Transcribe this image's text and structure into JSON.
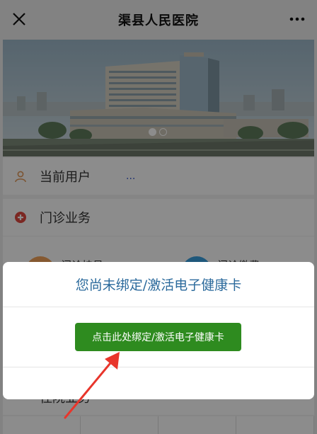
{
  "topbar": {
    "title": "渠县人民医院",
    "close_icon": "close-icon",
    "more_icon": "more-icon"
  },
  "banner": {
    "slides": 2,
    "active_slide": 1
  },
  "user": {
    "label": "当前用户",
    "value": "...",
    "icon": "user-icon"
  },
  "outpatient": {
    "label": "门诊业务",
    "icon": "plus-circle-icon"
  },
  "grid": {
    "items": [
      {
        "label": "门诊挂号",
        "icon": "register-icon"
      },
      {
        "label": "门诊缴费",
        "icon": "payment-icon"
      }
    ]
  },
  "inpatient": {
    "label": "住院业务"
  },
  "dialog": {
    "title": "您尚未绑定/激活电子健康卡",
    "button_label": "点击此处绑定/激活电子健康卡"
  },
  "colors": {
    "button_green": "#2e8b1f",
    "dialog_title": "#2b6a9c",
    "annotation_arrow": "#e8352b"
  }
}
